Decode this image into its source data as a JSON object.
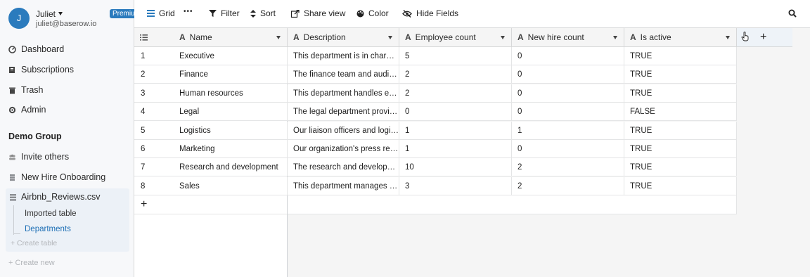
{
  "user": {
    "initial": "J",
    "name": "Juliet",
    "email": "juliet@baserow.io",
    "badge": "Premium"
  },
  "sidebar": {
    "nav": [
      {
        "label": "Dashboard",
        "icon": "dashboard-icon"
      },
      {
        "label": "Subscriptions",
        "icon": "subscriptions-icon"
      },
      {
        "label": "Trash",
        "icon": "trash-icon"
      },
      {
        "label": "Admin",
        "icon": "admin-icon"
      }
    ],
    "group_title": "Demo Group",
    "group_items": [
      {
        "label": "Invite others",
        "icon": "users-icon"
      },
      {
        "label": "New Hire Onboarding",
        "icon": "database-icon"
      }
    ],
    "database": {
      "label": "Airbnb_Reviews.csv",
      "tables": [
        "Imported table",
        "Departments"
      ],
      "create_table": "+ Create table"
    },
    "create_new": "+ Create new"
  },
  "toolbar": {
    "view": "Grid",
    "more": "•••",
    "filter": "Filter",
    "sort": "Sort",
    "share": "Share view",
    "color": "Color",
    "hide": "Hide Fields"
  },
  "grid": {
    "columns": [
      "Name",
      "Description",
      "Employee count",
      "New hire count",
      "Is active"
    ],
    "add_row": "+",
    "add_column": "+",
    "rows": [
      [
        "1",
        "Executive",
        "This department is in charg…",
        "5",
        "0",
        "TRUE"
      ],
      [
        "2",
        "Finance",
        "The finance team and audit…",
        "2",
        "0",
        "TRUE"
      ],
      [
        "3",
        "Human resources",
        "This department handles ev…",
        "2",
        "0",
        "TRUE"
      ],
      [
        "4",
        "Legal",
        "The legal department provi…",
        "0",
        "0",
        "FALSE"
      ],
      [
        "5",
        "Logistics",
        "Our liaison officers and logi…",
        "1",
        "1",
        "TRUE"
      ],
      [
        "6",
        "Marketing",
        "Our organization's press rel…",
        "1",
        "0",
        "TRUE"
      ],
      [
        "7",
        "Research and development",
        "The research and developm…",
        "10",
        "2",
        "TRUE"
      ],
      [
        "8",
        "Sales",
        "This department manages s…",
        "3",
        "2",
        "TRUE"
      ]
    ]
  },
  "colors": {
    "accent": "#2b7bbd",
    "active_link": "#1d6fb5",
    "sidebar_bg": "#f7f8fa"
  }
}
